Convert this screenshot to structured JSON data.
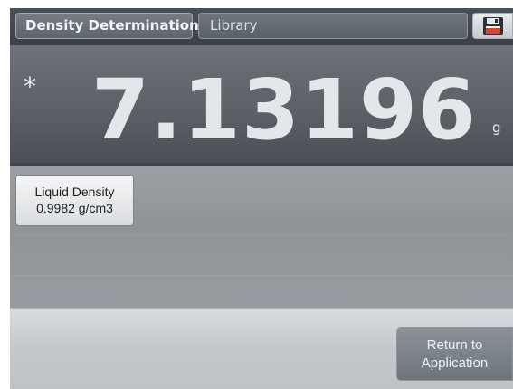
{
  "header": {
    "app_tab_label": "Density Determination",
    "library_tab_label": "Library",
    "save_icon": "floppy-disk-icon"
  },
  "display": {
    "stable_indicator": "*",
    "weight_value": "7.13196",
    "unit": "g"
  },
  "reference": {
    "liquid_density_title": "Liquid Density",
    "liquid_density_value": "0.9982 g/cm3"
  },
  "footer": {
    "return_button_line1": "Return to",
    "return_button_line2": "Application"
  },
  "colors": {
    "header_bg": "#3b4046",
    "display_bg": "#5b6167",
    "reference_bg": "#949a9f",
    "footer_bg": "#c5c9cc",
    "text_light": "#e4e7e9"
  }
}
